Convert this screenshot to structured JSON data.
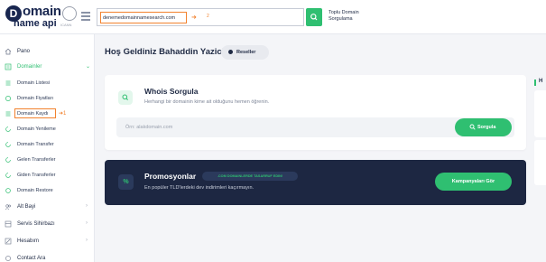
{
  "brand": {
    "logo_letter": "D",
    "logo_line1": "omain",
    "logo_line2": "name api",
    "seal_text": "ICANN"
  },
  "header": {
    "search_value": "denemedomainnamesearch.com",
    "search_annotation_arrow": "➜",
    "search_annotation_step": "2",
    "bulk_query_label": "Toplu Domain Sorgulama"
  },
  "sidebar": {
    "items": [
      {
        "label": "Pano",
        "icon": "home-icon"
      },
      {
        "label": "Domainler",
        "icon": "list-icon",
        "active": true
      },
      {
        "label": "Domain Listesi",
        "icon": "list-icon"
      },
      {
        "label": "Domain Fiyatları",
        "icon": "tag-icon"
      },
      {
        "label": "Domain Kaydı",
        "icon": "list-icon",
        "annotation": "➜1"
      },
      {
        "label": "Domain Yenileme",
        "icon": "refresh-icon"
      },
      {
        "label": "Domain Transfer",
        "icon": "transfer-icon"
      },
      {
        "label": "Gelen Transferler",
        "icon": "transfer-in-icon"
      },
      {
        "label": "Giden Transferler",
        "icon": "transfer-out-icon"
      },
      {
        "label": "Domain Restore",
        "icon": "restore-icon"
      },
      {
        "label": "Alt Bayi",
        "icon": "users-icon"
      },
      {
        "label": "Servis Sihirbazı",
        "icon": "wizard-icon"
      },
      {
        "label": "Hesabım",
        "icon": "account-icon"
      },
      {
        "label": "Contact Ara",
        "icon": "contact-icon"
      }
    ]
  },
  "main": {
    "welcome": "Hoş Geldiniz Bahaddin Yazici",
    "reseller_badge": "Reseller",
    "whois": {
      "title": "Whois Sorgula",
      "subtitle": "Herhangi bir domainin kime ait olduğunu hemen öğrenin.",
      "placeholder": "Örn: alakdomain.com",
      "button": "Sorgula"
    },
    "promo": {
      "title": "Promosyonlar",
      "badge": ".COM DOMAINLERDE TASARRUF EDIN!",
      "subtitle": "En popüler TLD'lerdeki dev indirimleri kaçırmayın.",
      "button": "Kampanyaları Gör"
    },
    "right_panel_head": "H"
  },
  "colors": {
    "accent_green": "#2fbf71",
    "navy": "#1d2742",
    "annotation_orange": "#f2822e"
  }
}
